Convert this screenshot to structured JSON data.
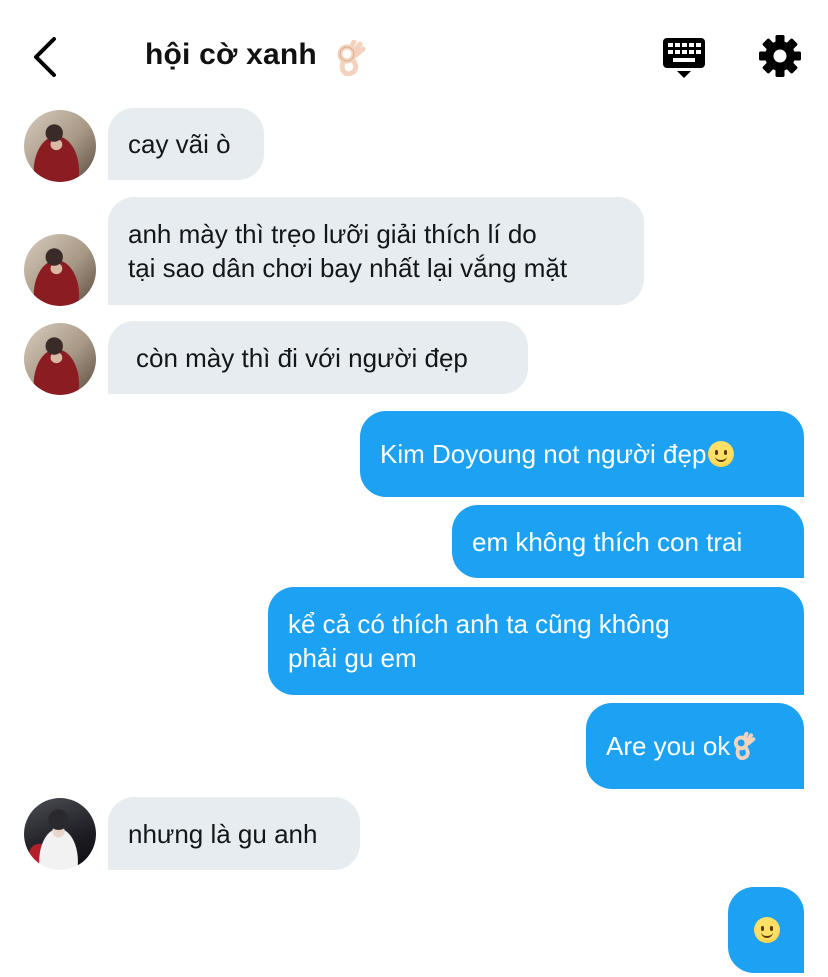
{
  "header": {
    "title": "hội cờ xanh",
    "title_emoji": "ok-hand-emoji",
    "back_icon": "chevron-left-icon",
    "keyboard_icon": "keyboard-icon",
    "settings_icon": "gear-icon"
  },
  "colors": {
    "incoming_bubble": "#e6ecf0",
    "outgoing_bubble": "#1da1f2",
    "icon": "#000000"
  },
  "messages": [
    {
      "direction": "incoming",
      "text": "cay vãi ò"
    },
    {
      "direction": "incoming",
      "text": "anh mày thì trẹo lưỡi giải thích lí do\ntại sao dân chơi bay nhất lại vắng mặt"
    },
    {
      "direction": "incoming",
      "text": "còn mày thì đi với người đẹp"
    },
    {
      "direction": "outgoing",
      "text": "Kim Doyoung not người đẹp",
      "trailing_emoji": "slightly-smiling-face"
    },
    {
      "direction": "outgoing",
      "text": "em không thích con trai"
    },
    {
      "direction": "outgoing",
      "text": "kể cả có thích anh ta cũng không\nphải gu em"
    },
    {
      "direction": "outgoing",
      "text": "Are you ok",
      "trailing_emoji": "ok-hand"
    },
    {
      "direction": "incoming",
      "text": "nhưng là gu anh"
    },
    {
      "direction": "outgoing",
      "text": "",
      "trailing_emoji": "slightly-smiling-face"
    }
  ]
}
